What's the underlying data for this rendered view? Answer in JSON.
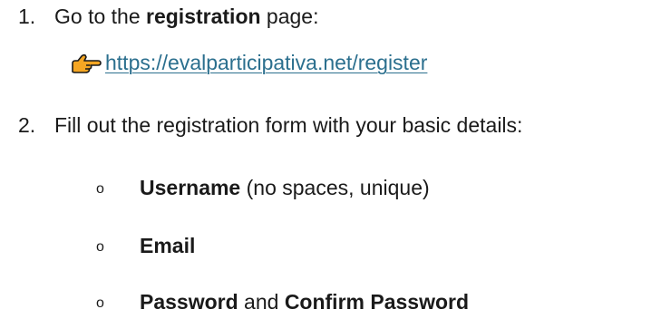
{
  "steps": [
    {
      "number": "1.",
      "pre": "Go to the ",
      "bold": "registration",
      "post": " page:",
      "link": "https://evalparticipativa.net/register",
      "link_icon": "pointing-hand-icon"
    },
    {
      "number": "2.",
      "text": "Fill out the registration form with your basic details:",
      "bullet_glyph": "o",
      "items": [
        {
          "bold": "Username",
          "rest": " (no spaces, unique)"
        },
        {
          "bold": "Email",
          "rest": ""
        },
        {
          "bold": "Password",
          "mid": " and ",
          "bold2": "Confirm Password"
        }
      ]
    }
  ],
  "colors": {
    "text": "#1a1a1a",
    "link": "#2b6f8e",
    "icon_fill": "#f5a623"
  }
}
